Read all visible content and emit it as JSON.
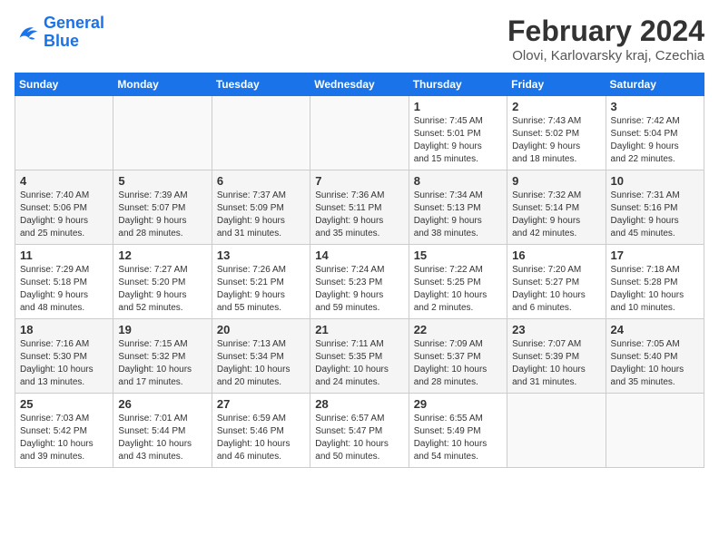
{
  "header": {
    "logo_line1": "General",
    "logo_line2": "Blue",
    "title": "February 2024",
    "subtitle": "Olovi, Karlovarsky kraj, Czechia"
  },
  "days_of_week": [
    "Sunday",
    "Monday",
    "Tuesday",
    "Wednesday",
    "Thursday",
    "Friday",
    "Saturday"
  ],
  "weeks": [
    [
      {
        "day": "",
        "info": ""
      },
      {
        "day": "",
        "info": ""
      },
      {
        "day": "",
        "info": ""
      },
      {
        "day": "",
        "info": ""
      },
      {
        "day": "1",
        "info": "Sunrise: 7:45 AM\nSunset: 5:01 PM\nDaylight: 9 hours\nand 15 minutes."
      },
      {
        "day": "2",
        "info": "Sunrise: 7:43 AM\nSunset: 5:02 PM\nDaylight: 9 hours\nand 18 minutes."
      },
      {
        "day": "3",
        "info": "Sunrise: 7:42 AM\nSunset: 5:04 PM\nDaylight: 9 hours\nand 22 minutes."
      }
    ],
    [
      {
        "day": "4",
        "info": "Sunrise: 7:40 AM\nSunset: 5:06 PM\nDaylight: 9 hours\nand 25 minutes."
      },
      {
        "day": "5",
        "info": "Sunrise: 7:39 AM\nSunset: 5:07 PM\nDaylight: 9 hours\nand 28 minutes."
      },
      {
        "day": "6",
        "info": "Sunrise: 7:37 AM\nSunset: 5:09 PM\nDaylight: 9 hours\nand 31 minutes."
      },
      {
        "day": "7",
        "info": "Sunrise: 7:36 AM\nSunset: 5:11 PM\nDaylight: 9 hours\nand 35 minutes."
      },
      {
        "day": "8",
        "info": "Sunrise: 7:34 AM\nSunset: 5:13 PM\nDaylight: 9 hours\nand 38 minutes."
      },
      {
        "day": "9",
        "info": "Sunrise: 7:32 AM\nSunset: 5:14 PM\nDaylight: 9 hours\nand 42 minutes."
      },
      {
        "day": "10",
        "info": "Sunrise: 7:31 AM\nSunset: 5:16 PM\nDaylight: 9 hours\nand 45 minutes."
      }
    ],
    [
      {
        "day": "11",
        "info": "Sunrise: 7:29 AM\nSunset: 5:18 PM\nDaylight: 9 hours\nand 48 minutes."
      },
      {
        "day": "12",
        "info": "Sunrise: 7:27 AM\nSunset: 5:20 PM\nDaylight: 9 hours\nand 52 minutes."
      },
      {
        "day": "13",
        "info": "Sunrise: 7:26 AM\nSunset: 5:21 PM\nDaylight: 9 hours\nand 55 minutes."
      },
      {
        "day": "14",
        "info": "Sunrise: 7:24 AM\nSunset: 5:23 PM\nDaylight: 9 hours\nand 59 minutes."
      },
      {
        "day": "15",
        "info": "Sunrise: 7:22 AM\nSunset: 5:25 PM\nDaylight: 10 hours\nand 2 minutes."
      },
      {
        "day": "16",
        "info": "Sunrise: 7:20 AM\nSunset: 5:27 PM\nDaylight: 10 hours\nand 6 minutes."
      },
      {
        "day": "17",
        "info": "Sunrise: 7:18 AM\nSunset: 5:28 PM\nDaylight: 10 hours\nand 10 minutes."
      }
    ],
    [
      {
        "day": "18",
        "info": "Sunrise: 7:16 AM\nSunset: 5:30 PM\nDaylight: 10 hours\nand 13 minutes."
      },
      {
        "day": "19",
        "info": "Sunrise: 7:15 AM\nSunset: 5:32 PM\nDaylight: 10 hours\nand 17 minutes."
      },
      {
        "day": "20",
        "info": "Sunrise: 7:13 AM\nSunset: 5:34 PM\nDaylight: 10 hours\nand 20 minutes."
      },
      {
        "day": "21",
        "info": "Sunrise: 7:11 AM\nSunset: 5:35 PM\nDaylight: 10 hours\nand 24 minutes."
      },
      {
        "day": "22",
        "info": "Sunrise: 7:09 AM\nSunset: 5:37 PM\nDaylight: 10 hours\nand 28 minutes."
      },
      {
        "day": "23",
        "info": "Sunrise: 7:07 AM\nSunset: 5:39 PM\nDaylight: 10 hours\nand 31 minutes."
      },
      {
        "day": "24",
        "info": "Sunrise: 7:05 AM\nSunset: 5:40 PM\nDaylight: 10 hours\nand 35 minutes."
      }
    ],
    [
      {
        "day": "25",
        "info": "Sunrise: 7:03 AM\nSunset: 5:42 PM\nDaylight: 10 hours\nand 39 minutes."
      },
      {
        "day": "26",
        "info": "Sunrise: 7:01 AM\nSunset: 5:44 PM\nDaylight: 10 hours\nand 43 minutes."
      },
      {
        "day": "27",
        "info": "Sunrise: 6:59 AM\nSunset: 5:46 PM\nDaylight: 10 hours\nand 46 minutes."
      },
      {
        "day": "28",
        "info": "Sunrise: 6:57 AM\nSunset: 5:47 PM\nDaylight: 10 hours\nand 50 minutes."
      },
      {
        "day": "29",
        "info": "Sunrise: 6:55 AM\nSunset: 5:49 PM\nDaylight: 10 hours\nand 54 minutes."
      },
      {
        "day": "",
        "info": ""
      },
      {
        "day": "",
        "info": ""
      }
    ]
  ]
}
